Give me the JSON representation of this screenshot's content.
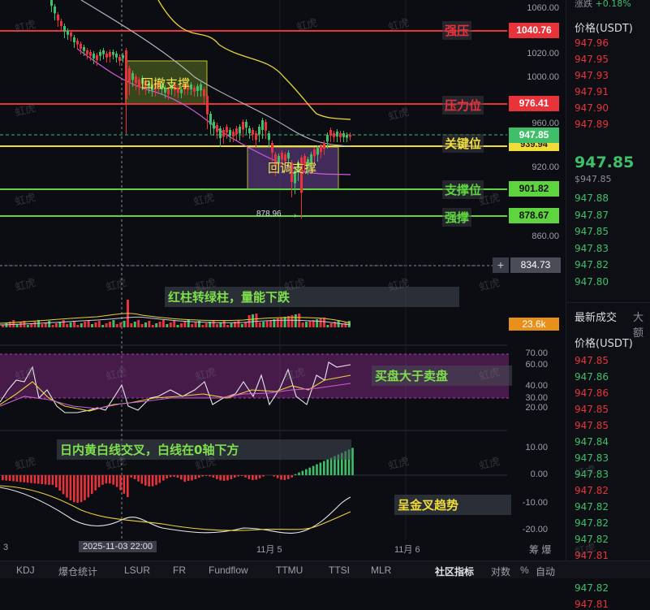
{
  "header": {
    "change_label": "涨跌",
    "change_value": "+0.18%"
  },
  "y_axis": {
    "price_ticks": [
      "1060.00",
      "1020.00",
      "1000.00",
      "960.00",
      "920.00",
      "860.00"
    ],
    "rsi_ticks": [
      "70.00",
      "60.00",
      "40.00",
      "30.00",
      "20.00"
    ],
    "macd_ticks": [
      "10.00",
      "0.00",
      "-10.00",
      "-20.00"
    ]
  },
  "levels": [
    {
      "label": "强压",
      "value": "1040.76",
      "color": "#e8333a",
      "label_color": "#e8333a"
    },
    {
      "label": "压力位",
      "value": "976.41",
      "color": "#e8333a",
      "label_color": "#e8333a"
    },
    {
      "label": "关键位",
      "value": "947.85",
      "color": "#f1dd3a",
      "label_color": "#f1dd3a"
    },
    {
      "label": "支撑位",
      "value": "901.82",
      "color": "#5ed53f",
      "label_color": "#5ed53f"
    },
    {
      "label": "强撑",
      "value": "878.67",
      "color": "#5ed53f",
      "label_color": "#5ed53f"
    }
  ],
  "price_tags": {
    "current": "947.85",
    "below_current": "939.94",
    "crosshair": "834.73",
    "volume": "23.6k"
  },
  "low_marker": "878.96",
  "boxes": {
    "pullback_support": "回撤支撑",
    "retrace_support": "回调支撑"
  },
  "annotations": {
    "volume": "红柱转绿柱，量能下跌",
    "rsi": "买盘大于卖盘",
    "macd_cross": "日内黄白线交叉，白线在0轴下方",
    "golden_cross": "呈金叉趋势"
  },
  "watermark": "虹虎",
  "time_axis": {
    "left_edge": "3",
    "crosshair_time": "2025-11-03 22:00",
    "nov5": "11月 5",
    "nov6": "11月 6",
    "right_label": "筹  爆"
  },
  "side_panel": {
    "price_header": "价格(USDT)",
    "ask_prices": [
      "947.96",
      "947.95",
      "947.93",
      "947.91",
      "947.90",
      "947.89"
    ],
    "last_price": "947.85",
    "last_price_sub": "$947.85",
    "bid_prices": [
      "947.88",
      "947.87",
      "947.85",
      "947.83",
      "947.82",
      "947.80"
    ],
    "trades_title": "最新成交",
    "trades_tab2": "大额",
    "trades_header": "价格(USDT)",
    "trades": [
      {
        "p": "947.85",
        "c": "#e8333a"
      },
      {
        "p": "947.86",
        "c": "#3fbf6a"
      },
      {
        "p": "947.86",
        "c": "#e8333a"
      },
      {
        "p": "947.85",
        "c": "#e8333a"
      },
      {
        "p": "947.85",
        "c": "#e8333a"
      },
      {
        "p": "947.84",
        "c": "#3fbf6a"
      },
      {
        "p": "947.83",
        "c": "#3fbf6a"
      },
      {
        "p": "947.83",
        "c": "#3fbf6a"
      },
      {
        "p": "947.82",
        "c": "#e8333a"
      },
      {
        "p": "947.82",
        "c": "#3fbf6a"
      },
      {
        "p": "947.82",
        "c": "#3fbf6a"
      },
      {
        "p": "947.82",
        "c": "#3fbf6a"
      },
      {
        "p": "947.81",
        "c": "#e8333a"
      },
      {
        "p": "947.81",
        "c": "#e8333a"
      },
      {
        "p": "947.82",
        "c": "#3fbf6a"
      },
      {
        "p": "947.81",
        "c": "#e8333a"
      }
    ]
  },
  "bottom_tabs": [
    "KDJ",
    "爆仓统计",
    "LSUR",
    "FR",
    "Fundflow",
    "TTMU",
    "TTSI",
    "MLR",
    "社区指标",
    "对数",
    "%",
    "自动"
  ],
  "colors": {
    "up": "#3fbf6a",
    "down": "#e8333a",
    "accent": "#f1dd3a"
  }
}
